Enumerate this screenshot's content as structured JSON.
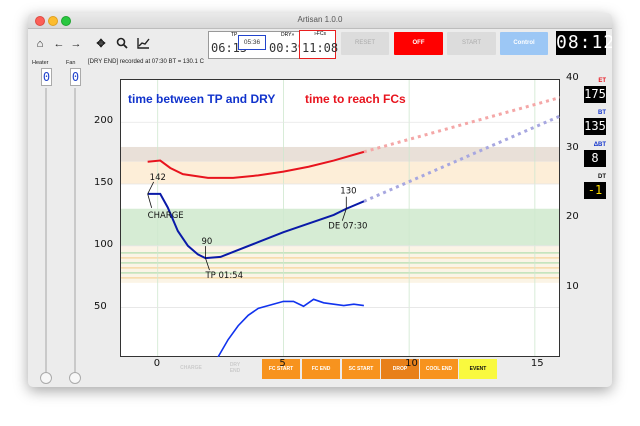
{
  "window": {
    "title": "Artisan 1.0.0"
  },
  "toolbar": {
    "icons": [
      "home-icon",
      "back-arrow-icon",
      "forward-arrow-icon",
      "pan-icon",
      "zoom-icon",
      "chart-icon"
    ],
    "lcd": {
      "tp_label": "TP",
      "tp_value": "06:15",
      "tp_box_value": "05:36",
      "dry_label": "DRY»",
      "dry_value": "00:39",
      "fcs_label": "»FCs",
      "fcs_value": "11:08"
    },
    "reset_label": "RESET",
    "off_label": "OFF",
    "start_label": "START",
    "control_label": "Control",
    "clock": "08:12"
  },
  "status_text": "[DRY END] recorded at 07:30 BT = 130.1 C",
  "sliders": {
    "heater_label": "Heater",
    "heater_value": "0",
    "fan_label": "Fan",
    "fan_value": "0"
  },
  "right_readouts": {
    "et_label": "ET",
    "et_value": "175",
    "bt_label": "BT",
    "bt_value": "135",
    "dbt_label": "ΔBT",
    "dbt_value": "8",
    "dt_label": "DT",
    "dt_value": "-1"
  },
  "events": {
    "charge_label": "CHARGE",
    "dry_end_label": "DRY END",
    "fc_start_label": "FC START",
    "fc_end_label": "FC END",
    "sc_start_label": "SC START",
    "drop_label": "DROP",
    "cool_end_label": "COOL END",
    "event_label": "EVENT"
  },
  "colors": {
    "et": "#e8141e",
    "bt": "#0a1aa8",
    "delta": "#1133ee",
    "off": "#ff0000",
    "orange": "#f7931e"
  },
  "chart_data": {
    "type": "line",
    "annotations": {
      "left_note": "time between TP and DRY",
      "right_note": "time to reach FCs",
      "charge_value": "142",
      "charge_text": "CHARGE",
      "tp_value": "90",
      "tp_text": "TP 01:54",
      "de_value": "130",
      "de_text": "DE 07:30"
    },
    "x_ticks": [
      "0",
      "5",
      "10",
      "15"
    ],
    "y_left_ticks": [
      "50",
      "100",
      "150",
      "200"
    ],
    "y_right_ticks": [
      "10",
      "20",
      "30",
      "40"
    ],
    "xlim": [
      -1.5,
      16
    ],
    "ylim": [
      10,
      235
    ],
    "y2lim": [
      0,
      40
    ],
    "series": [
      {
        "key": "et",
        "x": [
          -0.4,
          0.1,
          0.5,
          1.0,
          2.0,
          3.0,
          4.0,
          5.0,
          6.0,
          7.0,
          8.2
        ],
        "y": [
          168,
          169,
          163,
          158,
          155,
          155,
          157,
          160,
          164,
          169,
          176
        ]
      },
      {
        "key": "bt",
        "x": [
          -0.4,
          0.1,
          0.4,
          0.8,
          1.2,
          1.6,
          1.9,
          2.5,
          3.0,
          4.0,
          5.0,
          6.0,
          7.0,
          7.5,
          8.2
        ],
        "y": [
          142,
          142,
          131,
          112,
          100,
          93,
          90,
          91,
          95,
          103,
          111,
          118,
          125,
          130,
          136
        ]
      },
      {
        "key": "delta",
        "x": [
          2.4,
          2.8,
          3.2,
          3.6,
          4.0,
          4.5,
          5.0,
          5.4,
          5.8,
          6.2,
          6.6,
          7.0,
          7.4,
          7.8,
          8.2
        ],
        "y2": [
          0,
          2.5,
          4.5,
          6.0,
          7.0,
          7.5,
          8.0,
          8.0,
          7.3,
          8.3,
          7.8,
          7.6,
          7.4,
          7.6,
          7.4
        ]
      }
    ],
    "projections": [
      {
        "key": "et",
        "x": [
          8.2,
          16
        ],
        "y": [
          176,
          220
        ]
      },
      {
        "key": "bt",
        "x": [
          8.2,
          16
        ],
        "y": [
          136,
          205
        ]
      }
    ],
    "bands": [
      {
        "y": [
          168,
          180
        ],
        "color": "#e9e0d8"
      },
      {
        "y": [
          150,
          168
        ],
        "color": "#fdeed8"
      },
      {
        "y": [
          132,
          150
        ],
        "color": "#ffffff"
      },
      {
        "y": [
          100,
          130
        ],
        "color": "#d6ecd4"
      },
      {
        "y": [
          70,
          100
        ],
        "color": "#fbf4e6"
      }
    ]
  }
}
